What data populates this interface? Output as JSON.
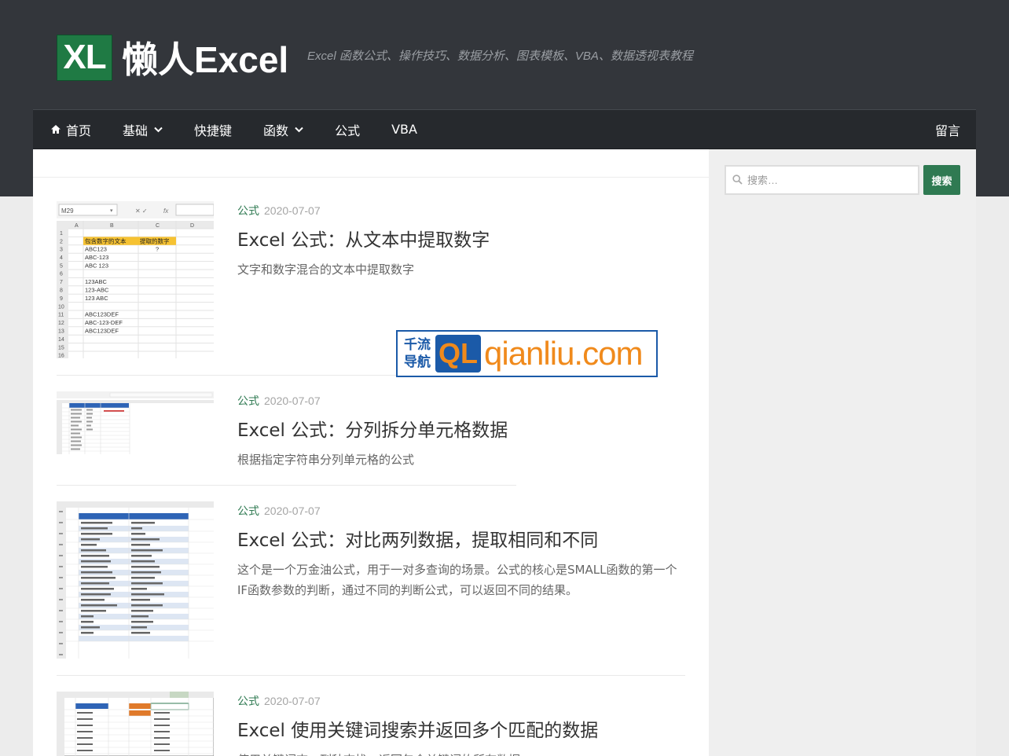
{
  "header": {
    "logo_mark": "XL",
    "logo_text": "懒人Excel",
    "tagline": "Excel 函数公式、操作技巧、数据分析、图表模板、VBA、数据透视表教程"
  },
  "nav": {
    "home": "首页",
    "basics": "基础",
    "shortcuts": "快捷键",
    "functions": "函数",
    "formulas": "公式",
    "vba": "VBA",
    "guestbook": "留言"
  },
  "search": {
    "placeholder": "搜索…",
    "button": "搜索"
  },
  "posts": [
    {
      "category": "公式",
      "date": "2020-07-07",
      "title": "Excel 公式：从文本中提取数字",
      "excerpt": "文字和数字混合的文本中提取数字"
    },
    {
      "category": "公式",
      "date": "2020-07-07",
      "title": "Excel 公式：分列拆分单元格数据",
      "excerpt": "根据指定字符串分列单元格的公式"
    },
    {
      "category": "公式",
      "date": "2020-07-07",
      "title": "Excel 公式：对比两列数据，提取相同和不同",
      "excerpt": "这个是一个万金油公式，用于一对多查询的场景。公式的核心是SMALL函数的第一个IF函数参数的判断，通过不同的判断公式，可以返回不同的结果。"
    },
    {
      "category": "公式",
      "date": "2020-07-07",
      "title": "Excel 使用关键词搜索并返回多个匹配的数据",
      "excerpt": "使用关键词查，列种查找，返回包含关键词的所有数据"
    }
  ],
  "thumb1": {
    "namebox": "M29",
    "fx": "fx",
    "cols": [
      "A",
      "B",
      "C",
      "D"
    ],
    "header_b": "包含数字的文本",
    "header_c": "提取的数字",
    "q": "?",
    "cells": [
      "ABC123",
      "ABC-123",
      "ABC 123",
      "",
      "123ABC",
      "123-ABC",
      "123 ABC",
      "",
      "ABC123DEF",
      "ABC-123-DEF",
      "ABC123DEF"
    ]
  },
  "watermark": {
    "cn_top": "千流",
    "cn_bottom": "导航",
    "mark": "QL",
    "url": "qianliu.com"
  },
  "colors": {
    "header_bg": "#33363b",
    "nav_bg": "#26292d",
    "accent": "#2f7a52",
    "logo": "#1f7a44"
  }
}
